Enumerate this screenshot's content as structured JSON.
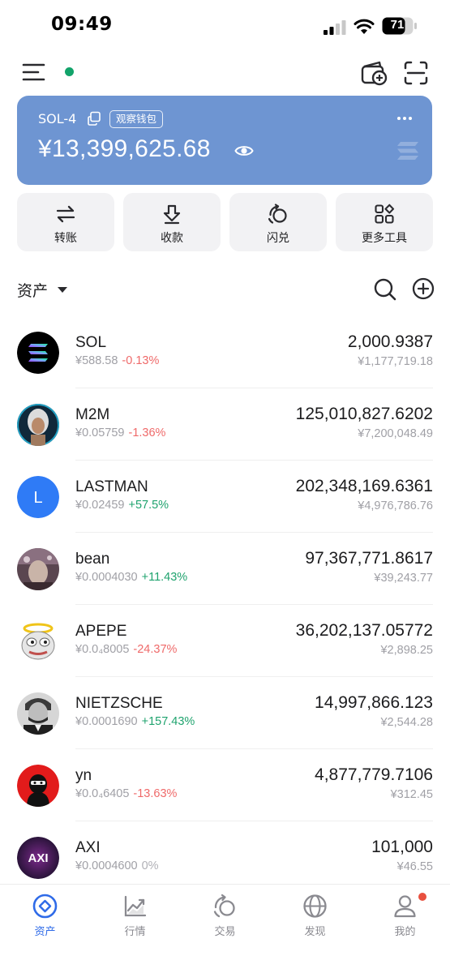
{
  "status_bar": {
    "time": "09:49",
    "battery": "71"
  },
  "wallet": {
    "name": "SOL-4",
    "badge": "观察钱包",
    "balance": "¥13,399,625.68"
  },
  "actions": [
    {
      "label": "转账",
      "icon": "transfer-icon"
    },
    {
      "label": "收款",
      "icon": "receive-icon"
    },
    {
      "label": "闪兑",
      "icon": "swap-icon"
    },
    {
      "label": "更多工具",
      "icon": "more-tools-icon"
    }
  ],
  "assets": {
    "title": "资产"
  },
  "tokens": [
    {
      "name": "SOL",
      "price": "¥588.58",
      "change": "-0.13%",
      "dir": "neg",
      "amount": "2,000.9387",
      "value": "¥1,177,719.18"
    },
    {
      "name": "M2M",
      "price": "¥0.05759",
      "change": "-1.36%",
      "dir": "neg",
      "amount": "125,010,827.6202",
      "value": "¥7,200,048.49"
    },
    {
      "name": "LASTMAN",
      "price": "¥0.02459",
      "change": "+57.5%",
      "dir": "pos",
      "amount": "202,348,169.6361",
      "value": "¥4,976,786.76",
      "initial": "L"
    },
    {
      "name": "bean",
      "price": "¥0.0004030",
      "change": "+11.43%",
      "dir": "pos",
      "amount": "97,367,771.8617",
      "value": "¥39,243.77"
    },
    {
      "name": "APEPE",
      "price": "¥0.0₄8005",
      "change": "-24.37%",
      "dir": "neg",
      "amount": "36,202,137.05772",
      "value": "¥2,898.25"
    },
    {
      "name": "NIETZSCHE",
      "price": "¥0.0001690",
      "change": "+157.43%",
      "dir": "pos",
      "amount": "14,997,866.123",
      "value": "¥2,544.28"
    },
    {
      "name": "yn",
      "price": "¥0.0₄6405",
      "change": "-13.63%",
      "dir": "neg",
      "amount": "4,877,779.7106",
      "value": "¥312.45"
    },
    {
      "name": "AXI",
      "price": "¥0.0004600",
      "change": "0%",
      "dir": "zero",
      "amount": "101,000",
      "value": "¥46.55",
      "logo_text": "AXI"
    }
  ],
  "tabs": [
    {
      "label": "资产",
      "active": true
    },
    {
      "label": "行情"
    },
    {
      "label": "交易"
    },
    {
      "label": "发现"
    },
    {
      "label": "我的"
    }
  ],
  "colors": {
    "card": "#6e95d2",
    "accent": "#2f6be8",
    "positive": "#1fa36e",
    "negative": "#ef6a6a",
    "online": "#12a36a"
  }
}
